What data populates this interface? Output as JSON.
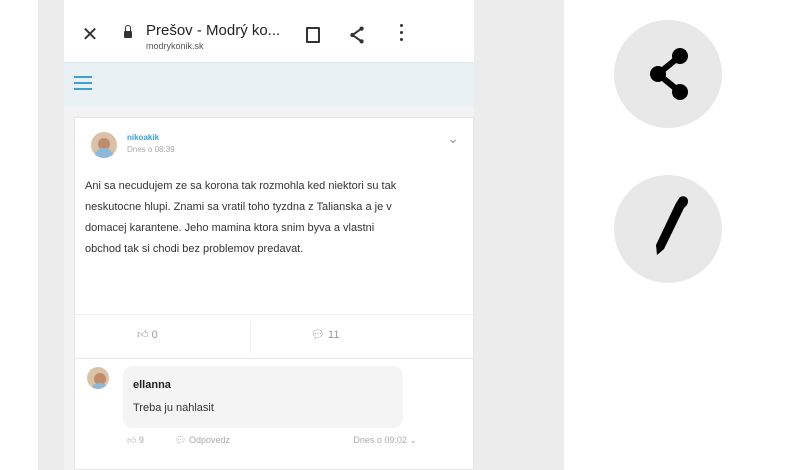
{
  "browser": {
    "page_title": "Prešov - Modrý ko...",
    "url": "modrykonik.sk"
  },
  "post": {
    "username": "nikoakik",
    "timestamp": "Dnes o 08:39",
    "text": "Ani sa necudujem ze sa korona tak rozmohla ked niektori su tak neskutocne hlupi. Znami sa vratil toho tyzdna z Talianska a je v domacej karantene. Jeho mamina ktora snim byva a vlastni obchod tak si chodi bez problemov predavat.",
    "likes": "0",
    "comments": "11"
  },
  "reply": {
    "username": "ellanna",
    "text": "Treba ju nahlasit",
    "likes": "9",
    "respond_label": "Odpovedz",
    "timestamp": "Dnes o 09:02"
  },
  "side_actions": {
    "share_icon": "share-icon",
    "edit_icon": "pencil-icon"
  },
  "colors": {
    "accent": "#3c9fd6",
    "panel_bg": "#ececec",
    "fab_bg": "#e8e8e8"
  }
}
